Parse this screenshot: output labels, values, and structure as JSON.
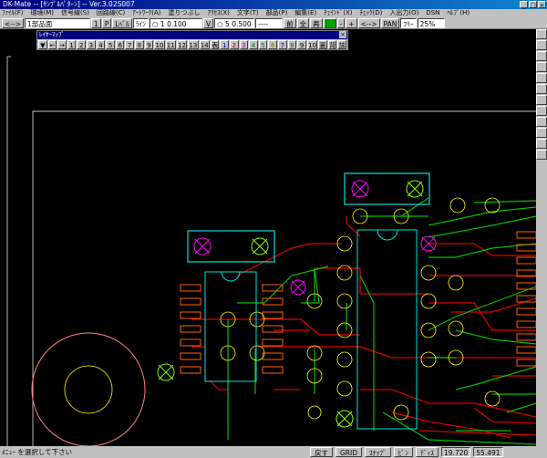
{
  "window": {
    "title": "DK-Mate -- [ｻﾝﾌﾟﾙﾊﾟﾀｰﾝ] -- Ver.3.02S007",
    "buttons": [
      "_",
      "□",
      "×"
    ]
  },
  "menu": [
    "ﾌｧｲﾙ(F)",
    "環境(M)",
    "信号線(S)",
    "回路線(C)",
    "ｱｰﾄﾜｰｸ(A)",
    "塗りつぶし",
    "ｱｸｾｽ(X)",
    "文字(T)",
    "部品(P)",
    "編集(E)",
    "ﾁｪｲﾝﾄﾞ(X)",
    "ﾁｪｯｸ(D)",
    "入出力(O)",
    "DSN",
    "ﾍﾙﾌﾟ(H)"
  ],
  "toolbar": {
    "items": [
      "<-->",
      "1部品面",
      "1",
      "P",
      "Lﾍﾞﾙ",
      "ﾗｲﾝ",
      "○ 1 0.100",
      "V",
      "○ 5 0.500",
      "----",
      "前",
      "全",
      "再",
      "",
      "-",
      "+",
      "<-->",
      "PAN",
      "ﾌﾘｰ",
      "25%"
    ]
  },
  "layer_palette": {
    "title": "ﾚｲﾔｰﾏｯﾌﾟ",
    "close": "×",
    "buttons": [
      "▼",
      "←",
      "→",
      "1",
      "2",
      "3",
      "4",
      "5",
      "6",
      "7",
      "8",
      "9",
      "10",
      "11",
      "12",
      "13",
      "14",
      "表",
      "1",
      "2",
      "3",
      "4",
      "5",
      "6",
      "7",
      "8",
      "9",
      "10",
      "裏",
      "背",
      "該"
    ]
  },
  "status": {
    "message": "ﾒﾆｭｰ     を選択して下さい",
    "buttons": [
      "戻す",
      "GRID",
      "ｽﾅｯﾌﾟ",
      "ﾋﾟﾝ",
      "ﾃﾞｨｽ"
    ],
    "x": "19.720",
    "y": "55.491"
  },
  "colors": {
    "canvas": "#000000",
    "board_outline": "#ffffff",
    "track_red": "#ff0000",
    "track_green": "#00c000",
    "pad": "#ffff00",
    "part_outline": "#00e0e0",
    "smd_pad": "#ff6000",
    "via_magenta": "#ff00ff",
    "via_green": "#80ff00"
  }
}
